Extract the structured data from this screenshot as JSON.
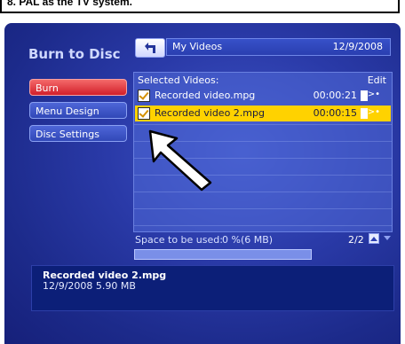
{
  "banner": {
    "text": "8. PAL as the TV system."
  },
  "window": {
    "title": "Burn to Disc"
  },
  "sidebar": {
    "items": [
      {
        "label": "Burn"
      },
      {
        "label": "Menu Design"
      },
      {
        "label": "Disc Settings"
      }
    ]
  },
  "header": {
    "folder_name": "My Videos",
    "date": "12/9/2008",
    "back_icon": "back-arrow-icon"
  },
  "list": {
    "header_label": "Selected Videos:",
    "edit_label": "Edit",
    "rows": [
      {
        "name": "Recorded video.mpg",
        "duration": "00:00:21",
        "selected": false
      },
      {
        "name": "Recorded video 2.mpg",
        "duration": "00:00:15",
        "selected": true
      }
    ]
  },
  "space": {
    "label": "Space to be used:",
    "value": "0 %(6 MB)",
    "progress": 0
  },
  "pagination": {
    "label": "2/2"
  },
  "details": {
    "file_name": "Recorded video 2.mpg",
    "meta": "12/9/2008  5.90 MB"
  },
  "colors": {
    "accent": "#ffd200",
    "burn_button": "#d21f2a",
    "background": "#2a3aa8"
  }
}
